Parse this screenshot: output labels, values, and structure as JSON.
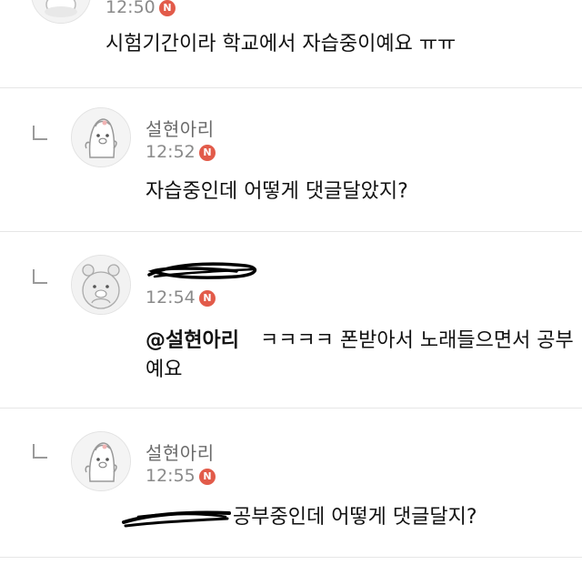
{
  "comments": [
    {
      "time": "12:50",
      "badge": "N",
      "text": "시험기간이라 학교에서 자습중이예요 ㅠㅠ"
    },
    {
      "nickname": "설현아리",
      "time": "12:52",
      "badge": "N",
      "text": "자습중인데 어떻게 댓글달았지?"
    },
    {
      "time": "12:54",
      "badge": "N",
      "mention": "@설현아리",
      "text_line1": "ㅋㅋㅋㅋ 폰받아서 노래들으면서 공부",
      "text_line2": "예요"
    },
    {
      "nickname": "설현아리",
      "time": "12:55",
      "badge": "N",
      "text": "공부중인데 어떻게 댓글달지?"
    }
  ]
}
